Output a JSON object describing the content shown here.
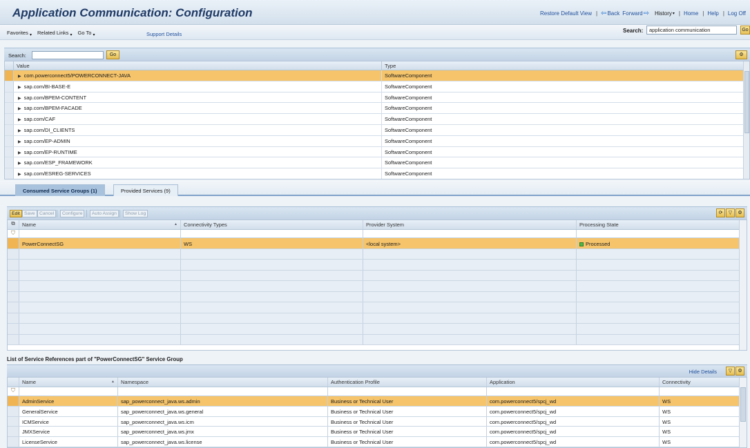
{
  "header": {
    "title": "Application Communication: Configuration",
    "restore_default": "Restore Default View",
    "back": "Back",
    "forward": "Forward",
    "history": "History",
    "home": "Home",
    "help": "Help",
    "logoff": "Log Off"
  },
  "subbar": {
    "favorites": "Favorites",
    "related_links": "Related Links",
    "goto": "Go To",
    "support_details": "Support Details",
    "search_label": "Search:",
    "search_value": "application communication",
    "search_go": "Go"
  },
  "panel1": {
    "search_label": "Search:",
    "search_value": "",
    "go_label": "Go",
    "columns": [
      "Value",
      "Type"
    ],
    "rows": [
      {
        "value": "com.powerconnect5/POWERCONNECT-JAVA",
        "type": "SoftwareComponent",
        "selected": true
      },
      {
        "value": "sap.com/BI-BASE-E",
        "type": "SoftwareComponent"
      },
      {
        "value": "sap.com/BPEM-CONTENT",
        "type": "SoftwareComponent"
      },
      {
        "value": "sap.com/BPEM-FACADE",
        "type": "SoftwareComponent"
      },
      {
        "value": "sap.com/CAF",
        "type": "SoftwareComponent"
      },
      {
        "value": "sap.com/DI_CLIENTS",
        "type": "SoftwareComponent"
      },
      {
        "value": "sap.com/EP-ADMIN",
        "type": "SoftwareComponent"
      },
      {
        "value": "sap.com/EP-RUNTIME",
        "type": "SoftwareComponent"
      },
      {
        "value": "sap.com/ESP_FRAMEWORK",
        "type": "SoftwareComponent"
      },
      {
        "value": "sap.com/ESREG-SERVICES",
        "type": "SoftwareComponent"
      }
    ]
  },
  "tabs": {
    "consumed": "Consumed Service Groups (1)",
    "provided": "Provided Services (9)"
  },
  "toolbar2": {
    "edit": "Edit",
    "save": "Save",
    "cancel": "Cancel",
    "configure": "Configure",
    "auto_assign": "Auto Assign",
    "show_log": "Show Log"
  },
  "consumed_groups": {
    "columns": [
      "Name",
      "Connectivity Types",
      "Provider System",
      "Processing State"
    ],
    "rows": [
      {
        "name": "PowerConnectSG",
        "connectivity": "WS",
        "provider": "<local system>",
        "state": "Processed",
        "selected": true
      }
    ]
  },
  "refs": {
    "title": "List of Service References part of \"PowerConnectSG\" Service Group",
    "hide_details": "Hide Details",
    "columns": [
      "Name",
      "Namespace",
      "Authentication Profile",
      "Application",
      "Connectivity"
    ],
    "rows": [
      {
        "name": "AdminService",
        "namespace": "sap_powerconnect_java.ws.admin",
        "auth": "Business or Technical User",
        "app": "com.powerconnect5/spcj_wd",
        "conn": "WS",
        "selected": true
      },
      {
        "name": "GeneralService",
        "namespace": "sap_powerconnect_java.ws.general",
        "auth": "Business or Technical User",
        "app": "com.powerconnect5/spcj_wd",
        "conn": "WS"
      },
      {
        "name": "ICMService",
        "namespace": "sap_powerconnect_java.ws.icm",
        "auth": "Business or Technical User",
        "app": "com.powerconnect5/spcj_wd",
        "conn": "WS"
      },
      {
        "name": "JMXService",
        "namespace": "sap_powerconnect_java.ws.jmx",
        "auth": "Business or Technical User",
        "app": "com.powerconnect5/spcj_wd",
        "conn": "WS"
      },
      {
        "name": "LicenseService",
        "namespace": "sap_powerconnect_java.ws.license",
        "auth": "Business or Technical User",
        "app": "com.powerconnect5/spcj_wd",
        "conn": "WS"
      }
    ]
  },
  "colors": {
    "selection": "#f5c46b",
    "title": "#1f3a66",
    "link": "#1f4f9c",
    "status_ok": "#4cbb4a"
  }
}
